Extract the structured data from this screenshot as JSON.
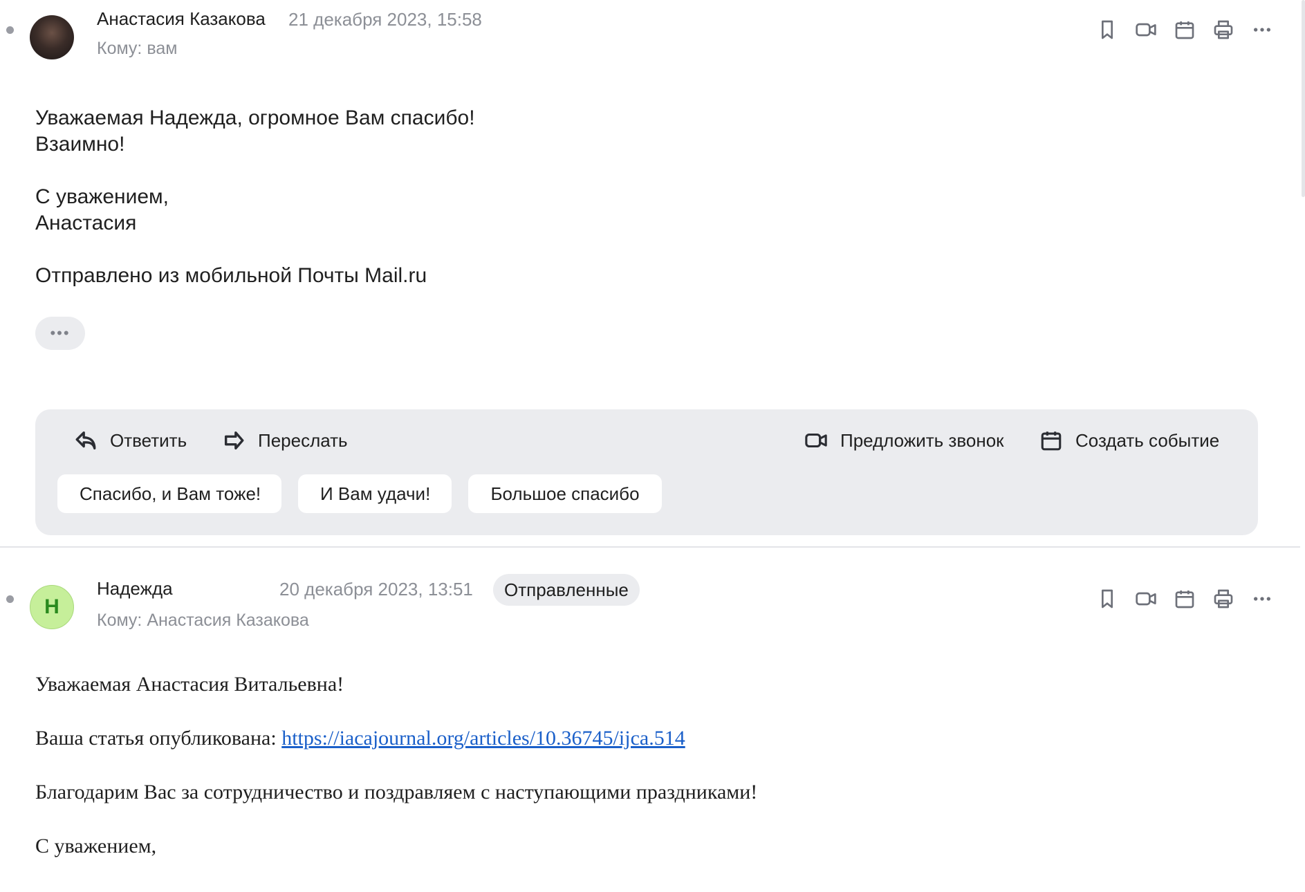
{
  "message1": {
    "sender": "Анастасия Казакова",
    "date": "21 декабря 2023, 15:58",
    "to": "Кому: вам",
    "body_lines": [
      "Уважаемая Надежда, огромное Вам спасибо!",
      "Взаимно!",
      "",
      "С уважением,",
      "Анастасия",
      "",
      "Отправлено из мобильной Почты Mail.ru"
    ],
    "more_label": "•••",
    "actions": {
      "reply": "Ответить",
      "forward": "Переслать",
      "suggest_call": "Предложить звонок",
      "create_event": "Создать событие"
    },
    "quick_replies": [
      "Спасибо, и Вам тоже!",
      "И Вам удачи!",
      "Большое спасибо"
    ]
  },
  "message2": {
    "avatar_letter": "Н",
    "sender": "Надежда",
    "date": "20 декабря 2023, 13:51",
    "folder": "Отправленные",
    "to": "Кому: Анастасия Казакова",
    "greeting": "Уважаемая Анастасия Витальевна!",
    "published_prefix": "Ваша статья опубликована: ",
    "link": "https://iacajournal.org/articles/10.36745/ijca.514",
    "thanks": "Благодарим Вас за сотрудничество и поздравляем с наступающими праздниками!",
    "closing": "С уважением,"
  },
  "icons": [
    "bookmark-icon",
    "video-call-icon",
    "calendar-icon",
    "print-icon",
    "more-icon"
  ],
  "colors": {
    "muted_text": "#8c8f96",
    "panel_bg": "#ebecef",
    "avatar_green": "#c6ef9a",
    "link": "#1a5fc9"
  }
}
